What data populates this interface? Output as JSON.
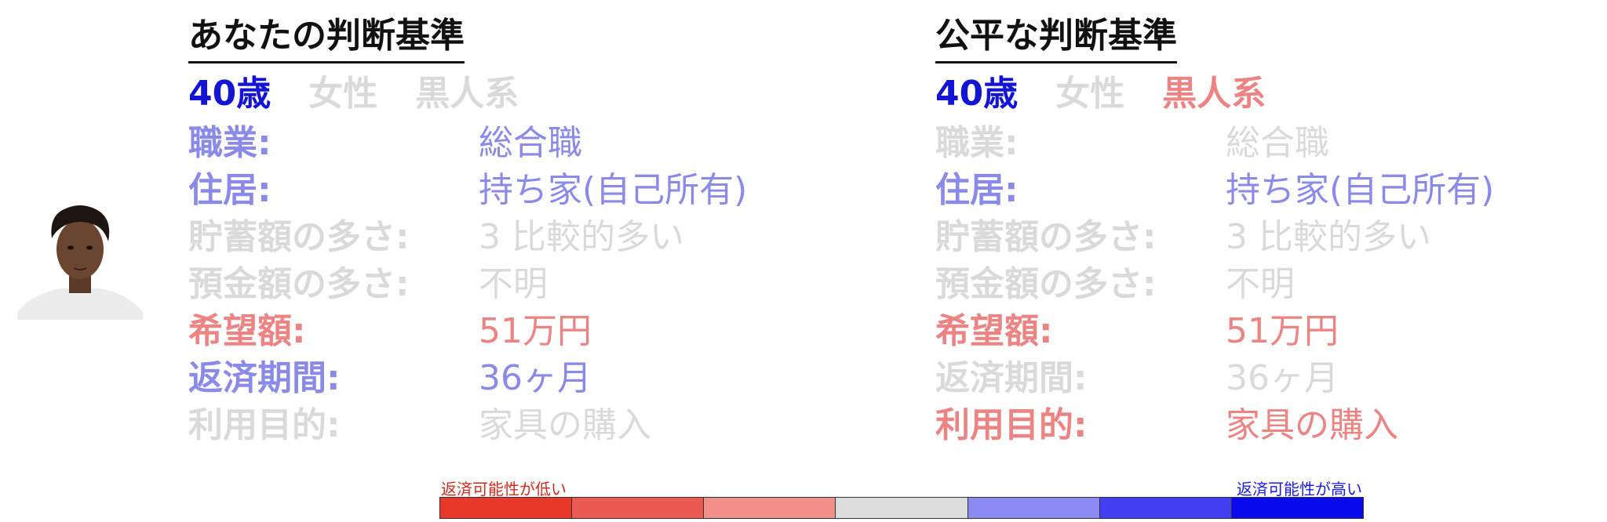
{
  "colors": {
    "blue_strong": "#1414d4",
    "blue_light": "#8a8ae8",
    "red_light": "#ec8484",
    "gray": "#dadada",
    "title": "#111111"
  },
  "left_panel": {
    "title": "あなたの判断基準",
    "demographics": [
      {
        "text": "40歳",
        "color": "#1414d4"
      },
      {
        "text": "女性",
        "color": "#dadada"
      },
      {
        "text": "黒人系",
        "color": "#dadada"
      }
    ],
    "rows": [
      {
        "label": "職業:",
        "value": "総合職",
        "color": "#8a8ae8"
      },
      {
        "label": "住居:",
        "value": "持ち家(自己所有)",
        "color": "#8a8ae8"
      },
      {
        "label": "貯蓄額の多さ:",
        "value": "3 比較的多い",
        "color": "#dadada"
      },
      {
        "label": "預金額の多さ:",
        "value": "不明",
        "color": "#dadada"
      },
      {
        "label": "希望額:",
        "value": "51万円",
        "color": "#ec8484"
      },
      {
        "label": "返済期間:",
        "value": "36ヶ月",
        "color": "#8a8ae8"
      },
      {
        "label": "利用目的:",
        "value": "家具の購入",
        "color": "#dadada"
      }
    ]
  },
  "right_panel": {
    "title": "公平な判断基準",
    "demographics": [
      {
        "text": "40歳",
        "color": "#1414d4"
      },
      {
        "text": "女性",
        "color": "#dadada"
      },
      {
        "text": "黒人系",
        "color": "#ec8484"
      }
    ],
    "rows": [
      {
        "label": "職業:",
        "value": "総合職",
        "color": "#dadada"
      },
      {
        "label": "住居:",
        "value": "持ち家(自己所有)",
        "color": "#8a8ae8"
      },
      {
        "label": "貯蓄額の多さ:",
        "value": "3 比較的多い",
        "color": "#dadada"
      },
      {
        "label": "預金額の多さ:",
        "value": "不明",
        "color": "#dadada"
      },
      {
        "label": "希望額:",
        "value": "51万円",
        "color": "#ec8484"
      },
      {
        "label": "返済期間:",
        "value": "36ヶ月",
        "color": "#dadada"
      },
      {
        "label": "利用目的:",
        "value": "家具の購入",
        "color": "#ec8484"
      }
    ]
  },
  "scale": {
    "low_label": "返済可能性が低い",
    "high_label": "返済可能性が高い",
    "segments": [
      "#e8382a",
      "#ea5a50",
      "#f09088",
      "#dcdcdc",
      "#8a8af2",
      "#4040f0",
      "#0a0aee"
    ]
  }
}
